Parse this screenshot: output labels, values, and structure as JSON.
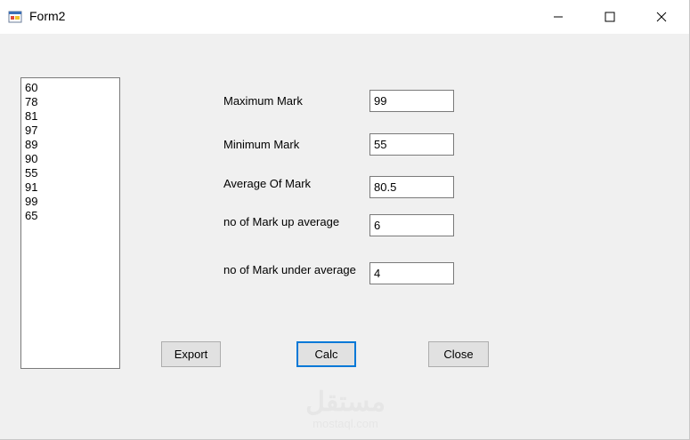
{
  "window": {
    "title": "Form2"
  },
  "titlebar_buttons": {
    "minimize_icon": "minimize-icon",
    "maximize_icon": "maximize-icon",
    "close_icon": "close-icon"
  },
  "marks_list": [
    "60",
    "78",
    "81",
    "97",
    "89",
    "90",
    "55",
    "91",
    "99",
    "65"
  ],
  "stats": {
    "max_label": "Maximum Mark",
    "max_value": "99",
    "min_label": "Minimum Mark",
    "min_value": "55",
    "avg_label": "Average Of Mark",
    "avg_value": "80.5",
    "up_label": "no of Mark up average",
    "up_value": "6",
    "under_label": "no of Mark under average",
    "under_value": "4"
  },
  "buttons": {
    "export": "Export",
    "calc": "Calc",
    "close": "Close"
  },
  "watermark": {
    "arabic": "مستقل",
    "latin": "mostaql.com"
  },
  "colors": {
    "accent": "#0078d7",
    "titlebar": "#ffffff",
    "client": "#f0f0f0"
  }
}
